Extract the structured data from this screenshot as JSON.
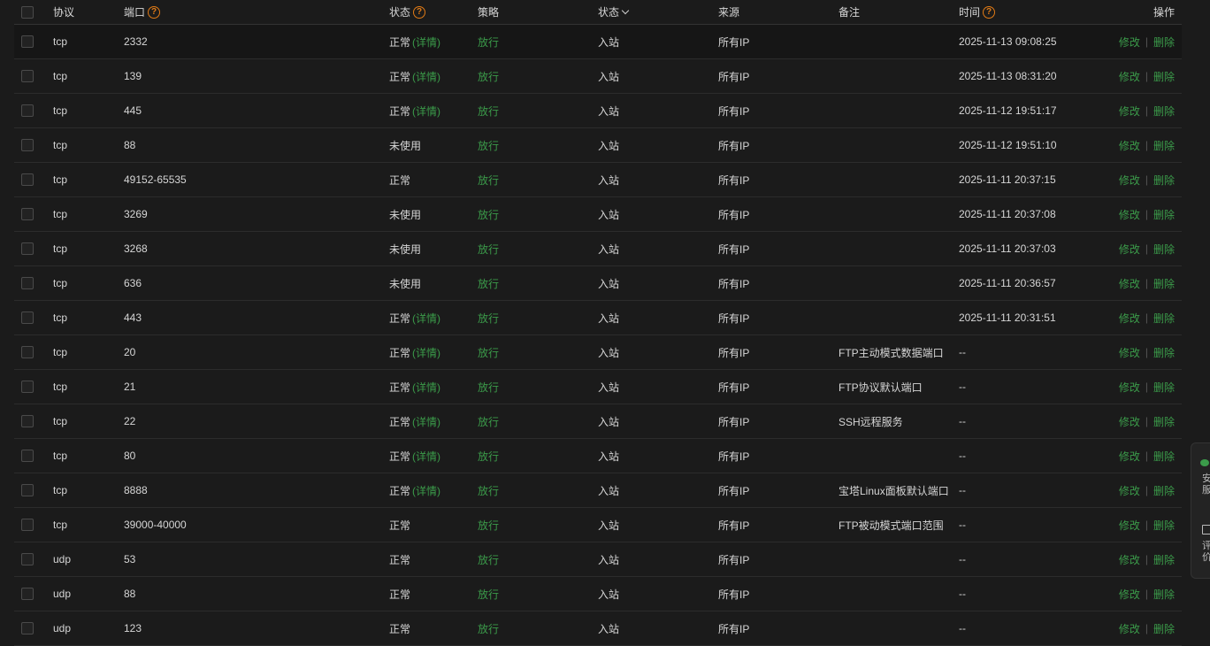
{
  "header": {
    "protocol": "协议",
    "port": "端口",
    "status": "状态",
    "policy": "策略",
    "direction": "状态",
    "source": "来源",
    "note": "备注",
    "time": "时间",
    "ops": "操作",
    "help_glyph": "?"
  },
  "labels": {
    "detail": "(详情)",
    "edit": "修改",
    "delete": "删除",
    "sep": "|"
  },
  "side_panel": {
    "line1": "安",
    "line2": "服",
    "line3": "评",
    "line4": "价"
  },
  "rows": [
    {
      "proto": "tcp",
      "port": "2332",
      "status": "正常",
      "detail": true,
      "policy": "放行",
      "dir": "入站",
      "src": "所有IP",
      "note": "",
      "time": "2025-11-13 09:08:25"
    },
    {
      "proto": "tcp",
      "port": "139",
      "status": "正常",
      "detail": true,
      "policy": "放行",
      "dir": "入站",
      "src": "所有IP",
      "note": "",
      "time": "2025-11-13 08:31:20"
    },
    {
      "proto": "tcp",
      "port": "445",
      "status": "正常",
      "detail": true,
      "policy": "放行",
      "dir": "入站",
      "src": "所有IP",
      "note": "",
      "time": "2025-11-12 19:51:17"
    },
    {
      "proto": "tcp",
      "port": "88",
      "status": "未使用",
      "detail": false,
      "policy": "放行",
      "dir": "入站",
      "src": "所有IP",
      "note": "",
      "time": "2025-11-12 19:51:10"
    },
    {
      "proto": "tcp",
      "port": "49152-65535",
      "status": "正常",
      "detail": false,
      "policy": "放行",
      "dir": "入站",
      "src": "所有IP",
      "note": "",
      "time": "2025-11-11 20:37:15"
    },
    {
      "proto": "tcp",
      "port": "3269",
      "status": "未使用",
      "detail": false,
      "policy": "放行",
      "dir": "入站",
      "src": "所有IP",
      "note": "",
      "time": "2025-11-11 20:37:08"
    },
    {
      "proto": "tcp",
      "port": "3268",
      "status": "未使用",
      "detail": false,
      "policy": "放行",
      "dir": "入站",
      "src": "所有IP",
      "note": "",
      "time": "2025-11-11 20:37:03"
    },
    {
      "proto": "tcp",
      "port": "636",
      "status": "未使用",
      "detail": false,
      "policy": "放行",
      "dir": "入站",
      "src": "所有IP",
      "note": "",
      "time": "2025-11-11 20:36:57"
    },
    {
      "proto": "tcp",
      "port": "443",
      "status": "正常",
      "detail": true,
      "policy": "放行",
      "dir": "入站",
      "src": "所有IP",
      "note": "",
      "time": "2025-11-11 20:31:51"
    },
    {
      "proto": "tcp",
      "port": "20",
      "status": "正常",
      "detail": true,
      "policy": "放行",
      "dir": "入站",
      "src": "所有IP",
      "note": "FTP主动模式数据端口",
      "time": "--"
    },
    {
      "proto": "tcp",
      "port": "21",
      "status": "正常",
      "detail": true,
      "policy": "放行",
      "dir": "入站",
      "src": "所有IP",
      "note": "FTP协议默认端口",
      "time": "--"
    },
    {
      "proto": "tcp",
      "port": "22",
      "status": "正常",
      "detail": true,
      "policy": "放行",
      "dir": "入站",
      "src": "所有IP",
      "note": "SSH远程服务",
      "time": "--"
    },
    {
      "proto": "tcp",
      "port": "80",
      "status": "正常",
      "detail": true,
      "policy": "放行",
      "dir": "入站",
      "src": "所有IP",
      "note": "",
      "time": "--"
    },
    {
      "proto": "tcp",
      "port": "8888",
      "status": "正常",
      "detail": true,
      "policy": "放行",
      "dir": "入站",
      "src": "所有IP",
      "note": "宝塔Linux面板默认端口",
      "time": "--"
    },
    {
      "proto": "tcp",
      "port": "39000-40000",
      "status": "正常",
      "detail": false,
      "policy": "放行",
      "dir": "入站",
      "src": "所有IP",
      "note": "FTP被动模式端口范围",
      "time": "--"
    },
    {
      "proto": "udp",
      "port": "53",
      "status": "正常",
      "detail": false,
      "policy": "放行",
      "dir": "入站",
      "src": "所有IP",
      "note": "",
      "time": "--"
    },
    {
      "proto": "udp",
      "port": "88",
      "status": "正常",
      "detail": false,
      "policy": "放行",
      "dir": "入站",
      "src": "所有IP",
      "note": "",
      "time": "--"
    },
    {
      "proto": "udp",
      "port": "123",
      "status": "正常",
      "detail": false,
      "policy": "放行",
      "dir": "入站",
      "src": "所有IP",
      "note": "",
      "time": "--"
    }
  ]
}
